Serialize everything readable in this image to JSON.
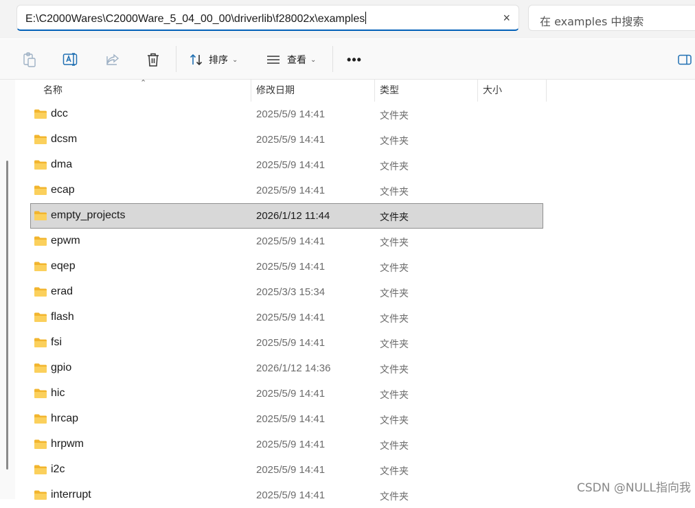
{
  "address_bar": {
    "path": "E:\\C2000Wares\\C2000Ware_5_04_00_00\\driverlib\\f28002x\\examples",
    "clear_icon": "×"
  },
  "search": {
    "placeholder": "在 examples 中搜索"
  },
  "toolbar": {
    "sort_label": "排序",
    "view_label": "查看",
    "more_label": "•••"
  },
  "columns": {
    "name": "名称",
    "modified": "修改日期",
    "type": "类型",
    "size": "大小"
  },
  "files": [
    {
      "name": "dcc",
      "modified": "2025/5/9 14:41",
      "type": "文件夹",
      "selected": false
    },
    {
      "name": "dcsm",
      "modified": "2025/5/9 14:41",
      "type": "文件夹",
      "selected": false
    },
    {
      "name": "dma",
      "modified": "2025/5/9 14:41",
      "type": "文件夹",
      "selected": false
    },
    {
      "name": "ecap",
      "modified": "2025/5/9 14:41",
      "type": "文件夹",
      "selected": false
    },
    {
      "name": "empty_projects",
      "modified": "2026/1/12 11:44",
      "type": "文件夹",
      "selected": true
    },
    {
      "name": "epwm",
      "modified": "2025/5/9 14:41",
      "type": "文件夹",
      "selected": false
    },
    {
      "name": "eqep",
      "modified": "2025/5/9 14:41",
      "type": "文件夹",
      "selected": false
    },
    {
      "name": "erad",
      "modified": "2025/3/3 15:34",
      "type": "文件夹",
      "selected": false
    },
    {
      "name": "flash",
      "modified": "2025/5/9 14:41",
      "type": "文件夹",
      "selected": false
    },
    {
      "name": "fsi",
      "modified": "2025/5/9 14:41",
      "type": "文件夹",
      "selected": false
    },
    {
      "name": "gpio",
      "modified": "2026/1/12 14:36",
      "type": "文件夹",
      "selected": false
    },
    {
      "name": "hic",
      "modified": "2025/5/9 14:41",
      "type": "文件夹",
      "selected": false
    },
    {
      "name": "hrcap",
      "modified": "2025/5/9 14:41",
      "type": "文件夹",
      "selected": false
    },
    {
      "name": "hrpwm",
      "modified": "2025/5/9 14:41",
      "type": "文件夹",
      "selected": false
    },
    {
      "name": "i2c",
      "modified": "2025/5/9 14:41",
      "type": "文件夹",
      "selected": false
    },
    {
      "name": "interrupt",
      "modified": "2025/5/9 14:41",
      "type": "文件夹",
      "selected": false
    }
  ],
  "watermark": "CSDN @NULL指向我",
  "colors": {
    "accent": "#005fb8",
    "folder": "#f8c54a",
    "selected_bg": "#d8d8d8"
  }
}
